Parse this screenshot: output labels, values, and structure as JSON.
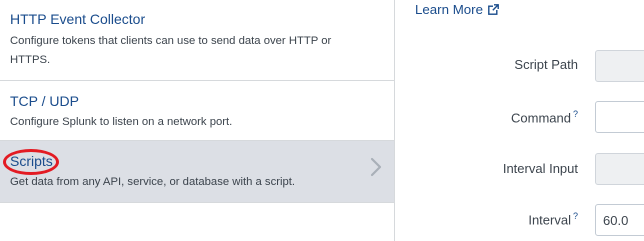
{
  "input_types": [
    {
      "title": "HTTP Event Collector",
      "description": "Configure tokens that clients can use to send data over HTTP or HTTPS."
    },
    {
      "title": "TCP / UDP",
      "description": "Configure Splunk to listen on a network port."
    },
    {
      "title": "Scripts",
      "description": "Get data from any API, service, or database with a script."
    }
  ],
  "right_panel": {
    "learn_more": "Learn More",
    "fields": {
      "script_path": {
        "label": "Script Path",
        "value": ""
      },
      "command": {
        "label": "Command",
        "help": "?",
        "value": ""
      },
      "interval_input": {
        "label": "Interval Input",
        "value": ""
      },
      "interval": {
        "label": "Interval",
        "help": "?",
        "value": "60.0"
      }
    }
  },
  "colors": {
    "link": "#1a4c8c",
    "selected_row": "#dcdfe5",
    "highlight_ring": "#e31b23"
  },
  "icons": {
    "external_link": "external-link-icon",
    "chevron": "chevron-right-icon"
  }
}
